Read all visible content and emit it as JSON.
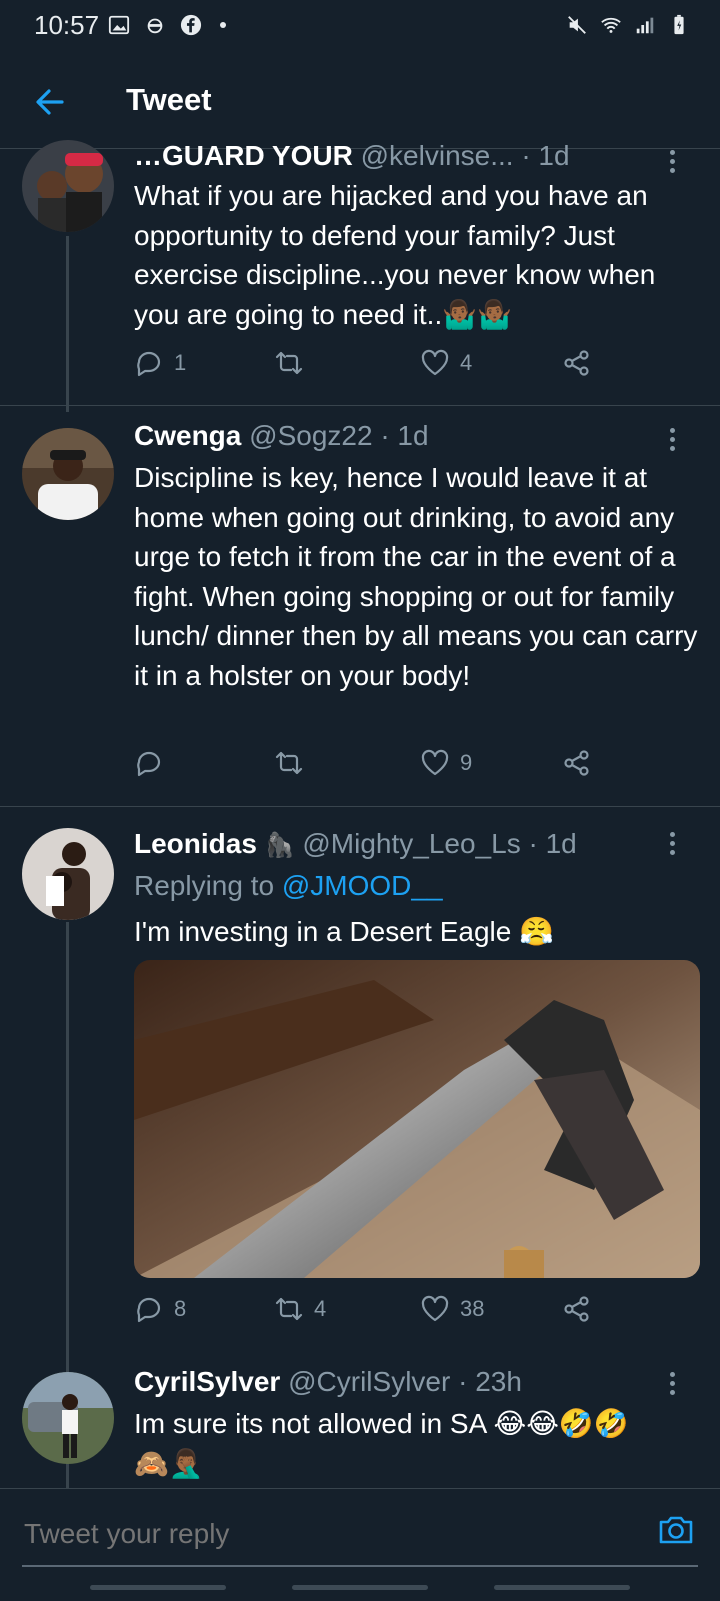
{
  "status": {
    "time": "10:57",
    "left_icons": [
      "gallery-icon",
      "ninja-icon",
      "facebook-icon",
      "dot-icon"
    ],
    "right_icons": [
      "mute-icon",
      "wifi-icon",
      "signal-icon",
      "battery-icon"
    ]
  },
  "header": {
    "title": "Tweet"
  },
  "tweets": [
    {
      "name": "…GUARD YOUR",
      "handle": "@kelvinse...",
      "time": "· 1d",
      "text": "What if you are hijacked and you have an opportunity to defend your family? Just exercise discipline...you never know when you are going to need it..🤷🏾‍♂️🤷🏾‍♂️",
      "replies": "1",
      "retweets": "",
      "likes": "4"
    },
    {
      "name": "Cwenga",
      "handle": "@Sogz22",
      "time": "· 1d",
      "text": "Discipline is key, hence I would leave it at home when going out drinking, to avoid any urge to fetch it from the car in the event of a fight. When going shopping or out for family lunch/ dinner then by all means you can carry it in a holster on your body!",
      "replies": "",
      "retweets": "",
      "likes": "9"
    },
    {
      "name": "Leonidas",
      "name_emoji": "🦍",
      "handle": "@Mighty_Leo_Ls",
      "time": "· 1d",
      "replying_prefix": "Replying to",
      "replying_to": "@JMOOD__",
      "text": "I'm investing in a Desert Eagle 😤",
      "replies": "8",
      "retweets": "4",
      "likes": "38"
    },
    {
      "name": "CyrilSylver",
      "handle": "@CyrilSylver",
      "time": "· 23h",
      "text": "Im sure its not allowed in SA 😂😂🤣🤣\n🙈🤦🏾‍♂️"
    }
  ],
  "reply": {
    "placeholder": "Tweet your reply"
  },
  "colors": {
    "background": "#15202b",
    "accent": "#1da1f2",
    "muted": "#8899a6",
    "border": "#38444d"
  }
}
